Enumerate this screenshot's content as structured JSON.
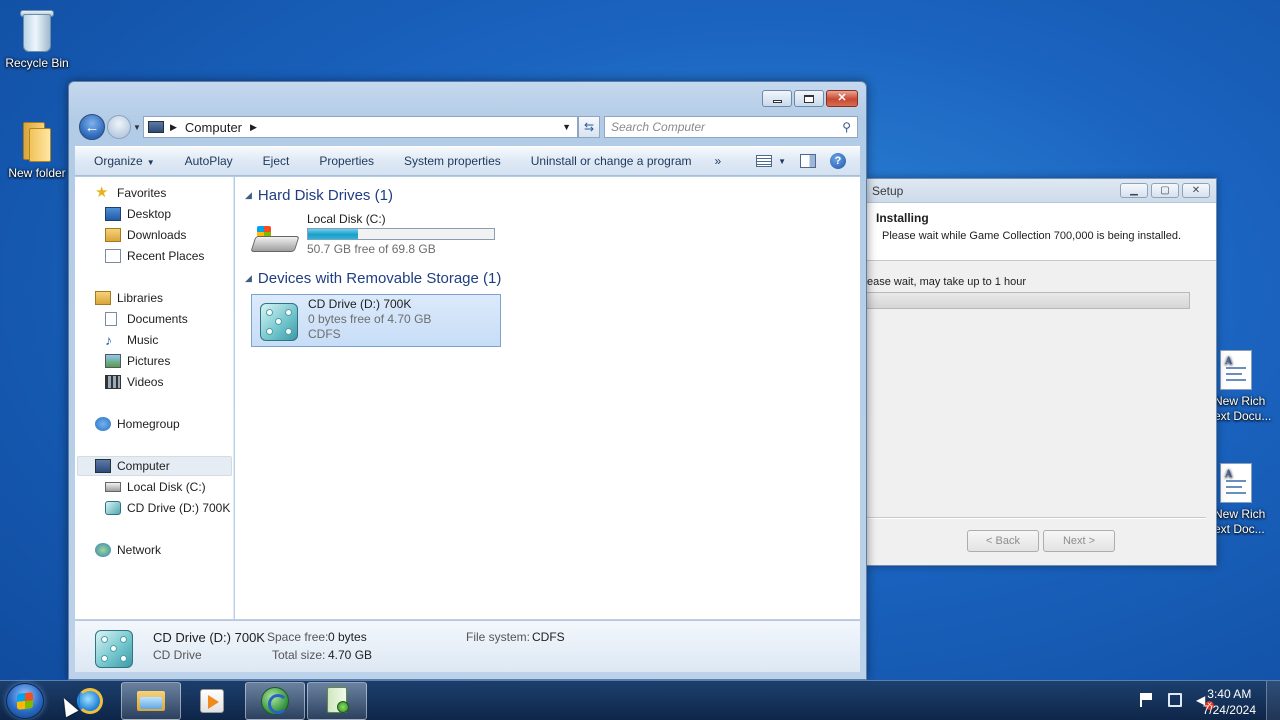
{
  "desktop": {
    "icons": [
      {
        "label": "Recycle Bin",
        "icon": "recycle-bin-icon"
      },
      {
        "label": "New folder",
        "icon": "folder-icon"
      },
      {
        "label_line1": "New Rich",
        "label_line2": "ext Docu...",
        "icon": "rich-text-document-icon"
      },
      {
        "label_line1": "New Rich",
        "label_line2": "ext Doc...",
        "icon": "rich-text-document-icon"
      }
    ]
  },
  "explorer": {
    "address": {
      "location": "Computer"
    },
    "search": {
      "placeholder": "Search Computer"
    },
    "toolbar": {
      "organize": "Organize",
      "autoplay": "AutoPlay",
      "eject": "Eject",
      "properties": "Properties",
      "system_properties": "System properties",
      "uninstall": "Uninstall or change a program",
      "more": "»"
    },
    "nav": {
      "favorites": "Favorites",
      "desktop": "Desktop",
      "downloads": "Downloads",
      "recent_places": "Recent Places",
      "libraries": "Libraries",
      "documents": "Documents",
      "music": "Music",
      "pictures": "Pictures",
      "videos": "Videos",
      "homegroup": "Homegroup",
      "computer": "Computer",
      "local_disk": "Local Disk (C:)",
      "cd_drive": "CD Drive (D:) 700K",
      "network": "Network"
    },
    "groups": {
      "hard_disk": "Hard Disk Drives (1)",
      "removable": "Devices with Removable Storage (1)"
    },
    "drives": {
      "c": {
        "name": "Local Disk (C:)",
        "free": "50.7 GB free of 69.8 GB",
        "used_fraction": 0.27
      },
      "d": {
        "name": "CD Drive (D:) 700K",
        "free": "0 bytes free of 4.70 GB",
        "fs": "CDFS"
      }
    },
    "details": {
      "name": "CD Drive (D:) 700K",
      "type": "CD Drive",
      "space_free_label": "Space free:",
      "space_free": "0 bytes",
      "total_size_label": "Total size:",
      "total_size": "4.70 GB",
      "fs_label": "File system:",
      "fs": "CDFS"
    }
  },
  "setup": {
    "title": "Setup",
    "heading": "Installing",
    "subheading": "Please wait while Game Collection 700,000 is being installed.",
    "message": "ease wait, may take up to 1 hour",
    "back": "< Back",
    "next": "Next >"
  },
  "taskbar": {
    "time": "3:40 AM",
    "date": "7/24/2024"
  }
}
